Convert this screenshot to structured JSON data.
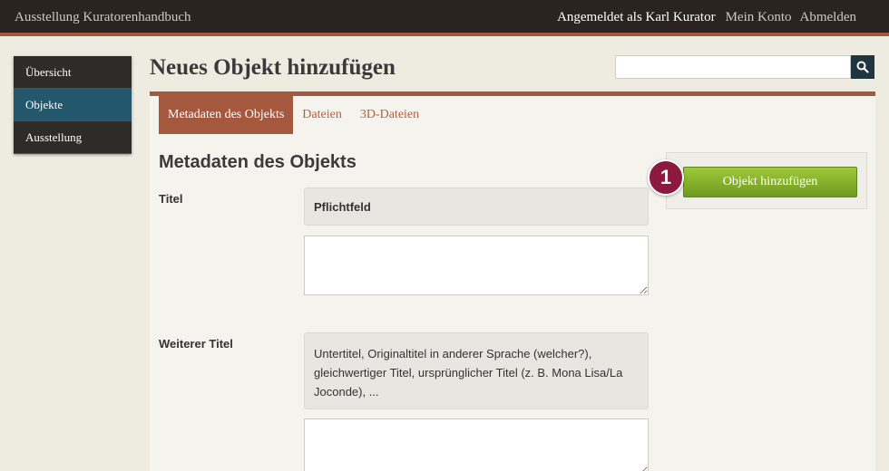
{
  "header": {
    "site_title": "Ausstellung Kuratorenhandbuch",
    "logged_in_as": "Angemeldet als Karl Kurator",
    "my_account": "Mein Konto",
    "logout": "Abmelden"
  },
  "sidebar": {
    "items": [
      {
        "label": "Übersicht"
      },
      {
        "label": "Objekte"
      },
      {
        "label": "Ausstellung"
      }
    ]
  },
  "page": {
    "title": "Neues Objekt hinzufügen"
  },
  "search": {
    "value": "",
    "icon": "search-icon"
  },
  "tabs": [
    {
      "label": "Metadaten des Objekts"
    },
    {
      "label": "Dateien"
    },
    {
      "label": "3D-Dateien"
    }
  ],
  "form": {
    "heading": "Metadaten des Objekts",
    "fields": [
      {
        "label": "Titel",
        "hint": "Pflichtfeld",
        "value": ""
      },
      {
        "label": "Weiterer Titel",
        "hint": "Untertitel, Originaltitel in anderer Sprache (welcher?), gleichwertiger Titel, ursprünglicher Titel (z. B. Mona Lisa/La Joconde), ...",
        "value": ""
      }
    ]
  },
  "actions": {
    "add_object": "Objekt hinzufügen"
  },
  "callout": {
    "number": "1"
  },
  "colors": {
    "accent": "#a4583d",
    "active_nav": "#24566c",
    "save_button": "#7fad28",
    "callout": "#8b1a3e"
  }
}
